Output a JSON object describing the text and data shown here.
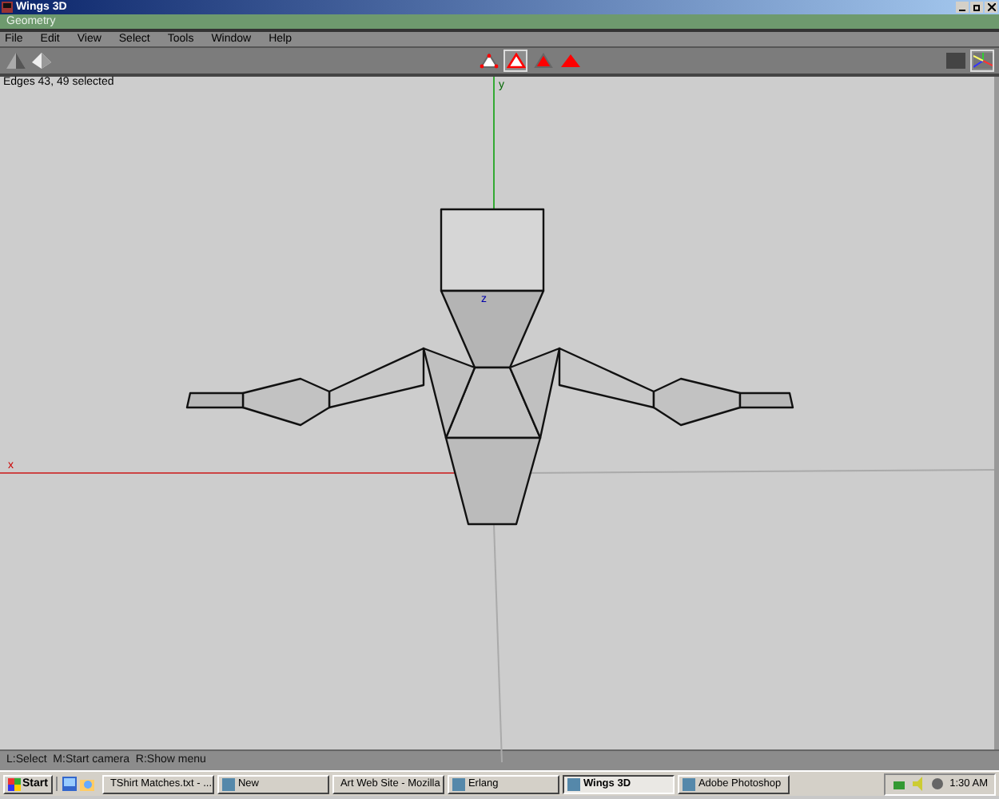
{
  "window": {
    "title": "Wings 3D"
  },
  "geometry_bar": {
    "title": "Geometry"
  },
  "menu": [
    "File",
    "Edit",
    "View",
    "Select",
    "Tools",
    "Window",
    "Help"
  ],
  "selection_modes": [
    {
      "kind": "vertex",
      "selected": false
    },
    {
      "kind": "edge",
      "selected": true
    },
    {
      "kind": "face",
      "selected": false
    },
    {
      "kind": "body",
      "selected": false
    }
  ],
  "view_buttons": [
    {
      "kind": "shaded",
      "selected": false
    },
    {
      "kind": "axes",
      "selected": true
    }
  ],
  "viewport": {
    "info": "Edges 43, 49 selected",
    "axis_labels": [
      {
        "kind": "x",
        "text": "x"
      },
      {
        "kind": "y",
        "text": "y"
      },
      {
        "kind": "z",
        "text": "z"
      }
    ]
  },
  "status_bar": "L:Select  M:Start camera  R:Show menu",
  "taskbar": {
    "start": "Start",
    "tasks": [
      {
        "label": "TShirt Matches.txt - ...",
        "selected": false
      },
      {
        "label": "New",
        "selected": false
      },
      {
        "label": "Art Web Site - Mozilla",
        "selected": false
      },
      {
        "label": "Erlang",
        "selected": false
      },
      {
        "label": "Wings 3D",
        "selected": true
      },
      {
        "label": "Adobe Photoshop",
        "selected": false
      }
    ],
    "clock": "1:30 AM"
  }
}
